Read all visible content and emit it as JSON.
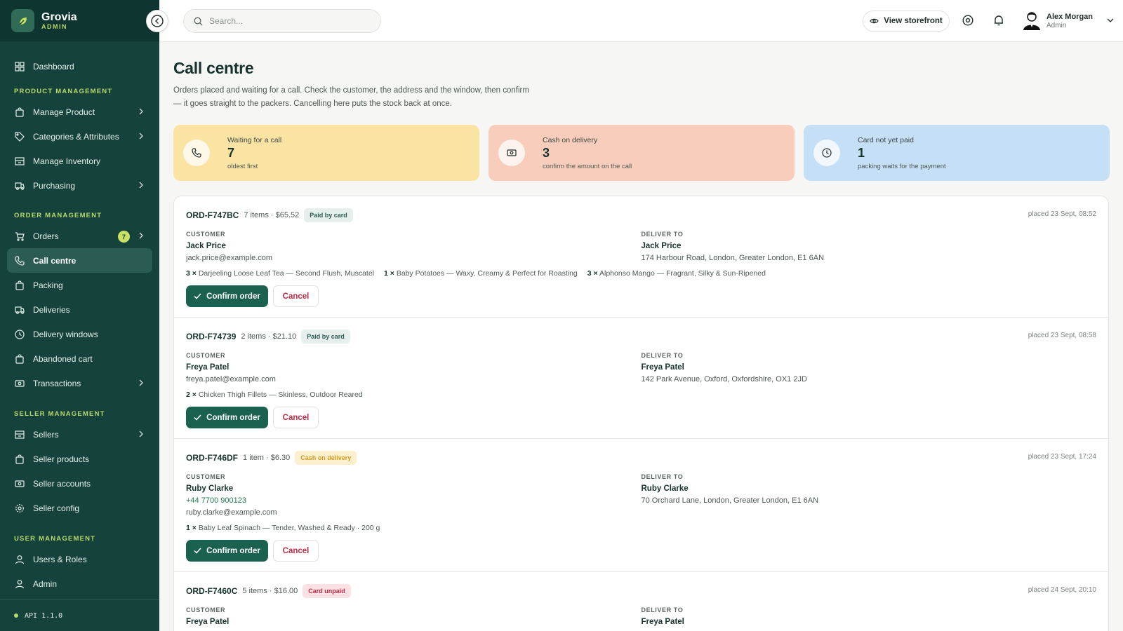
{
  "brand": {
    "name": "Grovia",
    "sub": "ADMIN"
  },
  "sidebar": {
    "dashboard": "Dashboard",
    "sections": [
      {
        "title": "PRODUCT MANAGEMENT",
        "items": [
          "Manage Product",
          "Categories & Attributes",
          "Manage Inventory",
          "Purchasing"
        ]
      },
      {
        "title": "ORDER MANAGEMENT",
        "items": [
          "Orders",
          "Call centre",
          "Packing",
          "Deliveries",
          "Delivery windows",
          "Abandoned cart",
          "Transactions"
        ]
      },
      {
        "title": "SELLER MANAGEMENT",
        "items": [
          "Sellers",
          "Seller products",
          "Seller accounts",
          "Seller config"
        ]
      },
      {
        "title": "USER MANAGEMENT",
        "items": [
          "Users & Roles",
          "Admin"
        ]
      }
    ],
    "orders_badge": "7",
    "api_version": "API 1.1.0"
  },
  "topbar": {
    "search_placeholder": "Search...",
    "storefront_label": "View storefront",
    "user_name": "Alex Morgan",
    "user_role": "Admin"
  },
  "page": {
    "title": "Call centre",
    "description": "Orders placed and waiting for a call. Check the customer, the address and the window, then confirm — it goes straight to the packers. Cancelling here puts the stock back at once."
  },
  "stats": [
    {
      "label": "Waiting for a call",
      "value": "7",
      "sub": "oldest first",
      "color": "#fbe4a3"
    },
    {
      "label": "Cash on delivery",
      "value": "3",
      "sub": "confirm the amount on the call",
      "color": "#f8cdbb"
    },
    {
      "label": "Card not yet paid",
      "value": "1",
      "sub": "packing waits for the payment",
      "color": "#c5e0f6"
    }
  ],
  "labels": {
    "customer": "CUSTOMER",
    "deliver_to": "DELIVER TO",
    "confirm": "Confirm order",
    "cancel": "Cancel"
  },
  "orders": [
    {
      "id": "ORD-F747BC",
      "meta": "7 items · $65.52",
      "status": "Paid by card",
      "placed": "placed 23 Sept, 08:52",
      "customer": {
        "name": "Jack Price",
        "phone": "",
        "email": "jack.price@example.com"
      },
      "deliver": {
        "name": "Jack Price",
        "address": "174 Harbour Road, London, Greater London, E1 6AN"
      },
      "items": [
        {
          "qty": "3 ×",
          "name": "Darjeeling Loose Leaf Tea — Second Flush, Muscatel"
        },
        {
          "qty": "1 ×",
          "name": "Baby Potatoes — Waxy, Creamy & Perfect for Roasting"
        },
        {
          "qty": "3 ×",
          "name": "Alphonso Mango — Fragrant, Silky & Sun-Ripened"
        }
      ]
    },
    {
      "id": "ORD-F74739",
      "meta": "2 items · $21.10",
      "status": "Paid by card",
      "placed": "placed 23 Sept, 08:58",
      "customer": {
        "name": "Freya Patel",
        "phone": "",
        "email": "freya.patel@example.com"
      },
      "deliver": {
        "name": "Freya Patel",
        "address": "142 Park Avenue, Oxford, Oxfordshire, OX1 2JD"
      },
      "items": [
        {
          "qty": "2 ×",
          "name": "Chicken Thigh Fillets — Skinless, Outdoor Reared"
        }
      ]
    },
    {
      "id": "ORD-F746DF",
      "meta": "1 item · $6.30",
      "status": "Cash on delivery",
      "placed": "placed 23 Sept, 17:24",
      "customer": {
        "name": "Ruby Clarke",
        "phone": "+44 7700 900123",
        "email": "ruby.clarke@example.com"
      },
      "deliver": {
        "name": "Ruby Clarke",
        "address": "70 Orchard Lane, London, Greater London, E1 6AN"
      },
      "items": [
        {
          "qty": "1 ×",
          "name": "Baby Leaf Spinach — Tender, Washed & Ready · 200 g"
        }
      ]
    },
    {
      "id": "ORD-F7460C",
      "meta": "5 items · $16.00",
      "status": "Card unpaid",
      "placed": "placed 24 Sept, 20:10",
      "customer": {
        "name": "Freya Patel",
        "phone": "",
        "email": ""
      },
      "deliver": {
        "name": "Freya Patel",
        "address": ""
      },
      "items": []
    }
  ]
}
